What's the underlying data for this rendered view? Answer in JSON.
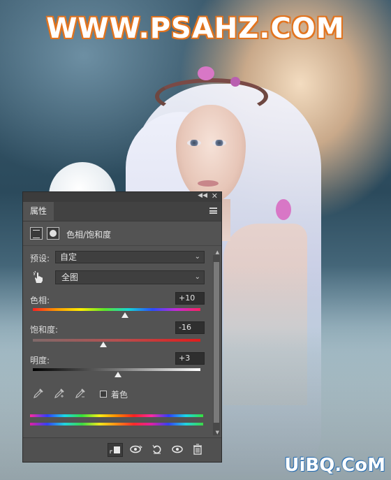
{
  "site": {
    "title": "WWW.PSAHZ.COM",
    "watermark": "UiBQ.CoM"
  },
  "panel": {
    "tab_label": "属性",
    "adjustment_label": "色相/饱和度",
    "preset": {
      "label": "预设:",
      "value": "自定"
    },
    "channel": {
      "value": "全图"
    },
    "hue": {
      "label": "色相:",
      "value": "+10",
      "level_percent": 55
    },
    "saturation": {
      "label": "饱和度:",
      "value": "-16",
      "level_percent": 42
    },
    "lightness": {
      "label": "明度:",
      "value": "+3",
      "level_percent": 51
    },
    "colorize": {
      "label": "着色",
      "checked": false
    },
    "icons": {
      "collapse": "double-chevron-icon",
      "close": "close-icon",
      "menu": "panel-menu-icon",
      "adjustment": "hue-saturation-icon",
      "mask": "mask-icon",
      "hand": "targeted-adjustment-hand-icon",
      "eyedroppers": [
        "eyedropper-icon",
        "eyedropper-add-icon",
        "eyedropper-subtract-icon"
      ],
      "footer": [
        "clip-to-layer-icon",
        "view-previous-state-icon",
        "reset-icon",
        "visibility-eye-icon",
        "delete-trash-icon"
      ]
    }
  }
}
